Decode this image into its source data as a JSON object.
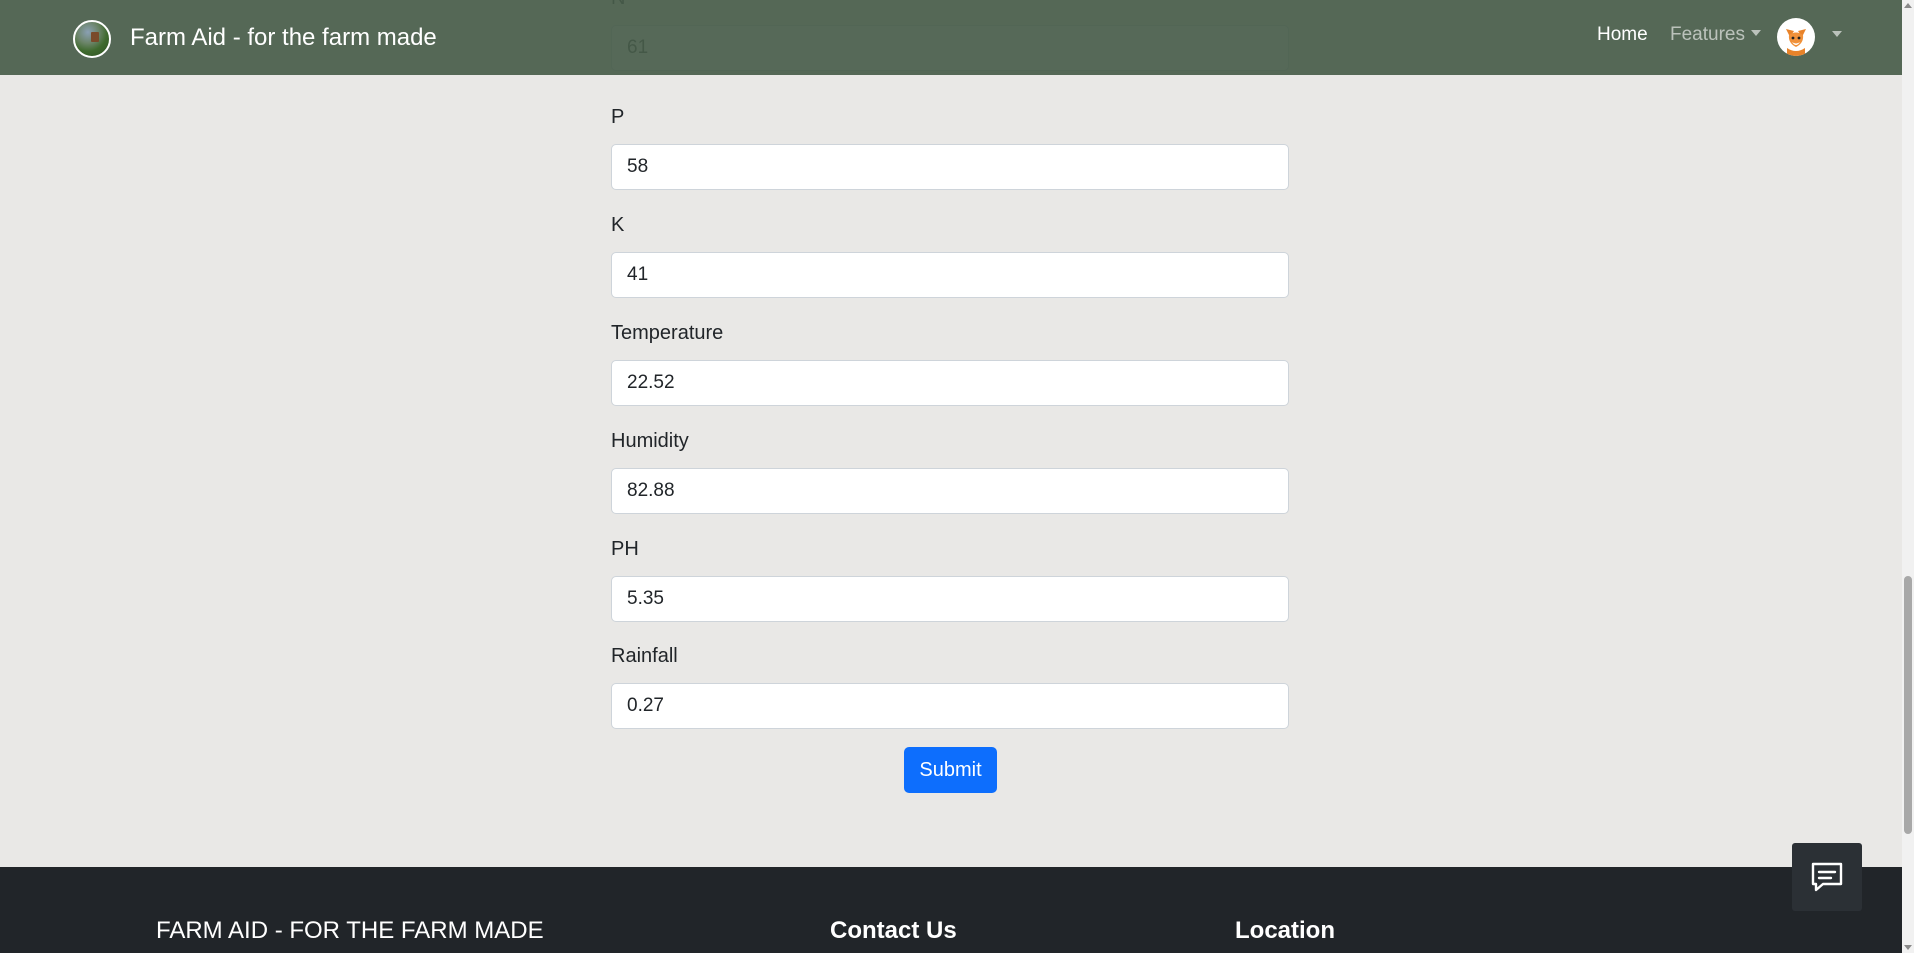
{
  "navbar": {
    "brand_title": "Farm Aid - for the farm made",
    "home_label": "Home",
    "features_label": "Features"
  },
  "form": {
    "fields": [
      {
        "label": "N",
        "value": "61"
      },
      {
        "label": "P",
        "value": "58"
      },
      {
        "label": "K",
        "value": "41"
      },
      {
        "label": "Temperature",
        "value": "22.52"
      },
      {
        "label": "Humidity",
        "value": "82.88"
      },
      {
        "label": "PH",
        "value": "5.35"
      },
      {
        "label": "Rainfall",
        "value": "0.27"
      }
    ],
    "submit_label": "Submit"
  },
  "footer": {
    "brand_heading": "FARM AID - FOR THE FARM MADE",
    "contact_heading": "Contact Us",
    "location_heading": "Location"
  },
  "colors": {
    "navbar_bg": "#485c4a",
    "page_bg": "#e9e8e6",
    "primary_button": "#0d6efd",
    "footer_bg": "#212529"
  },
  "icons": {
    "brand": "farm-logo-icon",
    "avatar": "fox-avatar-icon",
    "chat": "chat-bubble-icon"
  }
}
